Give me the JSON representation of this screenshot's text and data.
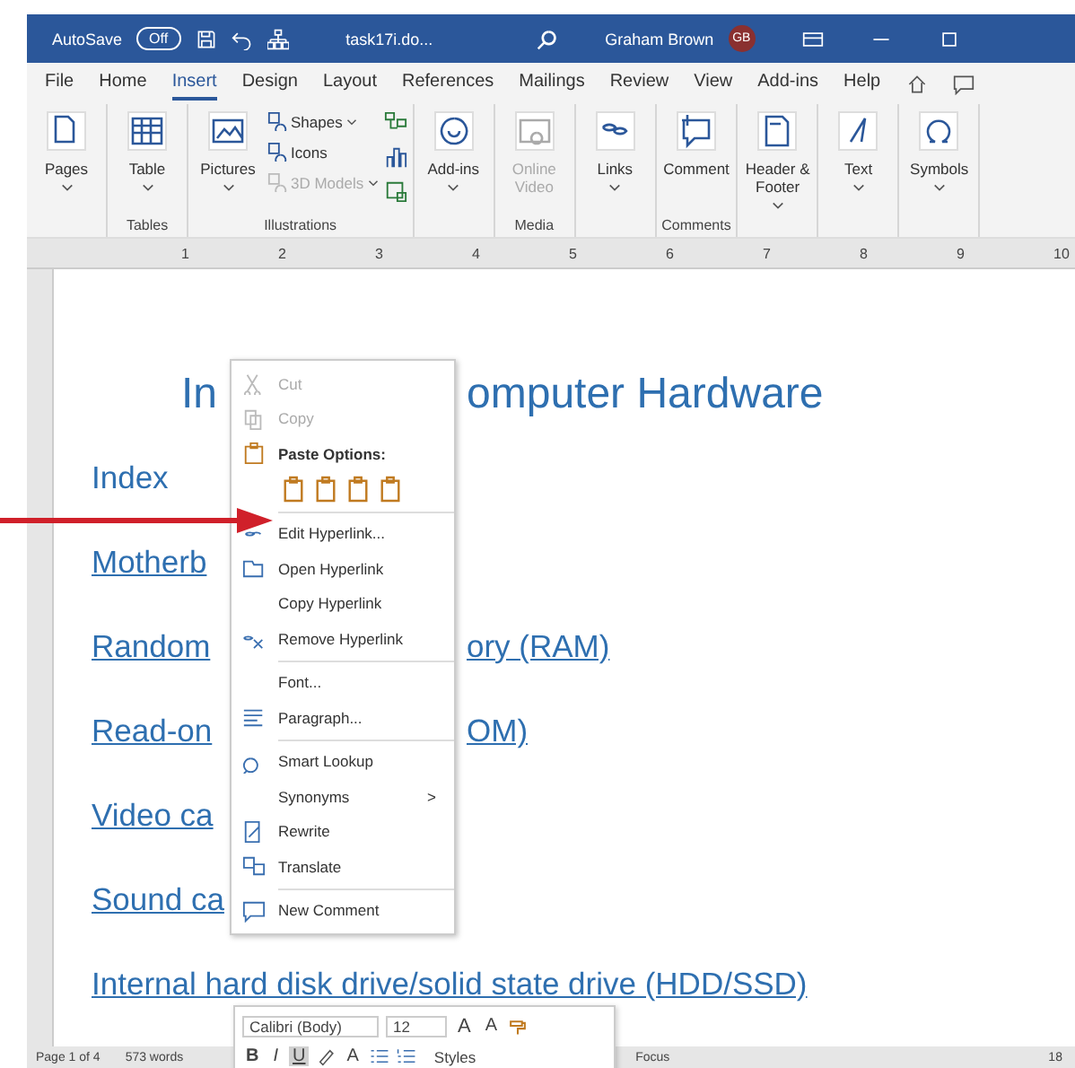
{
  "title_bar": {
    "autosave": {
      "label": "AutoSave",
      "on": false,
      "state_text": "Off"
    },
    "file_name": "task17i.do...",
    "user_name": "Graham Brown",
    "avatar_initials": "GB"
  },
  "tabs": [
    {
      "label": "File",
      "selected": false
    },
    {
      "label": "Home",
      "selected": false
    },
    {
      "label": "Insert",
      "selected": true
    },
    {
      "label": "Design",
      "selected": false
    },
    {
      "label": "Layout",
      "selected": false
    },
    {
      "label": "References",
      "selected": false
    },
    {
      "label": "Mailings",
      "selected": false
    },
    {
      "label": "Review",
      "selected": false
    },
    {
      "label": "View",
      "selected": false
    },
    {
      "label": "Add-ins",
      "selected": false
    },
    {
      "label": "Help",
      "selected": false
    }
  ],
  "ribbon": {
    "groups": [
      {
        "buttons": [
          {
            "label": "Pages",
            "kind": "large",
            "dropdown": true,
            "disabled": false
          }
        ]
      },
      {
        "label": "Tables",
        "buttons": [
          {
            "label": "Table",
            "kind": "large",
            "dropdown": true,
            "disabled": false
          }
        ]
      },
      {
        "label": "Illustrations",
        "buttons": [
          {
            "label": "Pictures",
            "kind": "large",
            "dropdown": true,
            "disabled": false
          },
          {
            "label": "Shapes",
            "kind": "small",
            "dropdown": true,
            "disabled": false
          },
          {
            "label": "Icons",
            "kind": "small",
            "dropdown": false,
            "disabled": false
          },
          {
            "label": "3D Models",
            "kind": "small",
            "dropdown": true,
            "disabled": true
          }
        ]
      },
      {
        "buttons": [
          {
            "label": "Add-ins",
            "kind": "large",
            "dropdown": true,
            "disabled": false
          }
        ]
      },
      {
        "label": "Media",
        "buttons": [
          {
            "label": "Online Video",
            "kind": "large",
            "dropdown": false,
            "disabled": true
          }
        ]
      },
      {
        "buttons": [
          {
            "label": "Links",
            "kind": "large",
            "dropdown": true,
            "disabled": false
          }
        ]
      },
      {
        "label": "Comments",
        "buttons": [
          {
            "label": "Comment",
            "kind": "large",
            "dropdown": false,
            "disabled": false
          }
        ]
      },
      {
        "buttons": [
          {
            "label": "Header & Footer",
            "kind": "large",
            "dropdown": true,
            "disabled": false
          }
        ]
      },
      {
        "buttons": [
          {
            "label": "Text",
            "kind": "large",
            "dropdown": true,
            "disabled": false
          }
        ]
      },
      {
        "buttons": [
          {
            "label": "Symbols",
            "kind": "large",
            "dropdown": true,
            "disabled": false
          }
        ]
      }
    ]
  },
  "ruler": {
    "marks": [
      "1",
      "2",
      "3",
      "4",
      "5",
      "6",
      "7",
      "8",
      "9",
      "10"
    ]
  },
  "document": {
    "title": {
      "left": "In",
      "right": "omputer Hardware"
    },
    "lines": [
      {
        "left": "Index",
        "link": false
      },
      {
        "left": "Motherb",
        "link": true
      },
      {
        "left": "Random",
        "right": "ory (RAM)",
        "link": true
      },
      {
        "left": "Read-on",
        "right": "OM)",
        "link": true
      },
      {
        "left": "Video ca",
        "link": true
      },
      {
        "left": "Sound ca",
        "link": true
      },
      {
        "left": "Internal hard disk drive/solid state drive (HDD/SSD)",
        "link": true
      }
    ]
  },
  "context_menu": {
    "items": [
      {
        "kind": "item",
        "label": "Cut",
        "disabled": true
      },
      {
        "kind": "item",
        "label": "Copy",
        "disabled": true
      },
      {
        "kind": "header",
        "label": "Paste Options:"
      },
      {
        "kind": "paste_row"
      },
      {
        "kind": "separator"
      },
      {
        "kind": "item",
        "label": "Edit Hyperlink...",
        "disabled": false
      },
      {
        "kind": "item",
        "label": "Open Hyperlink",
        "disabled": false
      },
      {
        "kind": "item",
        "label": "Copy Hyperlink",
        "disabled": false
      },
      {
        "kind": "item",
        "label": "Remove Hyperlink",
        "disabled": false
      },
      {
        "kind": "separator"
      },
      {
        "kind": "item",
        "label": "Font...",
        "disabled": false
      },
      {
        "kind": "item",
        "label": "Paragraph...",
        "disabled": false
      },
      {
        "kind": "separator"
      },
      {
        "kind": "item",
        "label": "Smart Lookup",
        "disabled": false
      },
      {
        "kind": "submenu",
        "label": "Synonyms",
        "arrow": ">",
        "disabled": false
      },
      {
        "kind": "item",
        "label": "Rewrite",
        "disabled": false
      },
      {
        "kind": "item",
        "label": "Translate",
        "disabled": false
      },
      {
        "kind": "separator"
      },
      {
        "kind": "item",
        "label": "New Comment",
        "disabled": false
      }
    ]
  },
  "mini_toolbar": {
    "font": "Calibri (Body)",
    "size": "12",
    "grow_font": "A",
    "shrink_font": "A",
    "format_buttons": [
      {
        "label": "B",
        "active": false
      },
      {
        "label": "I",
        "active": false
      },
      {
        "label": "U",
        "active": true
      }
    ],
    "font_color": "A",
    "styles_label": "Styles"
  },
  "status_bar": {
    "page": "Page 1 of 4",
    "words": "573 words",
    "focus": "Focus",
    "zoom": "18"
  }
}
